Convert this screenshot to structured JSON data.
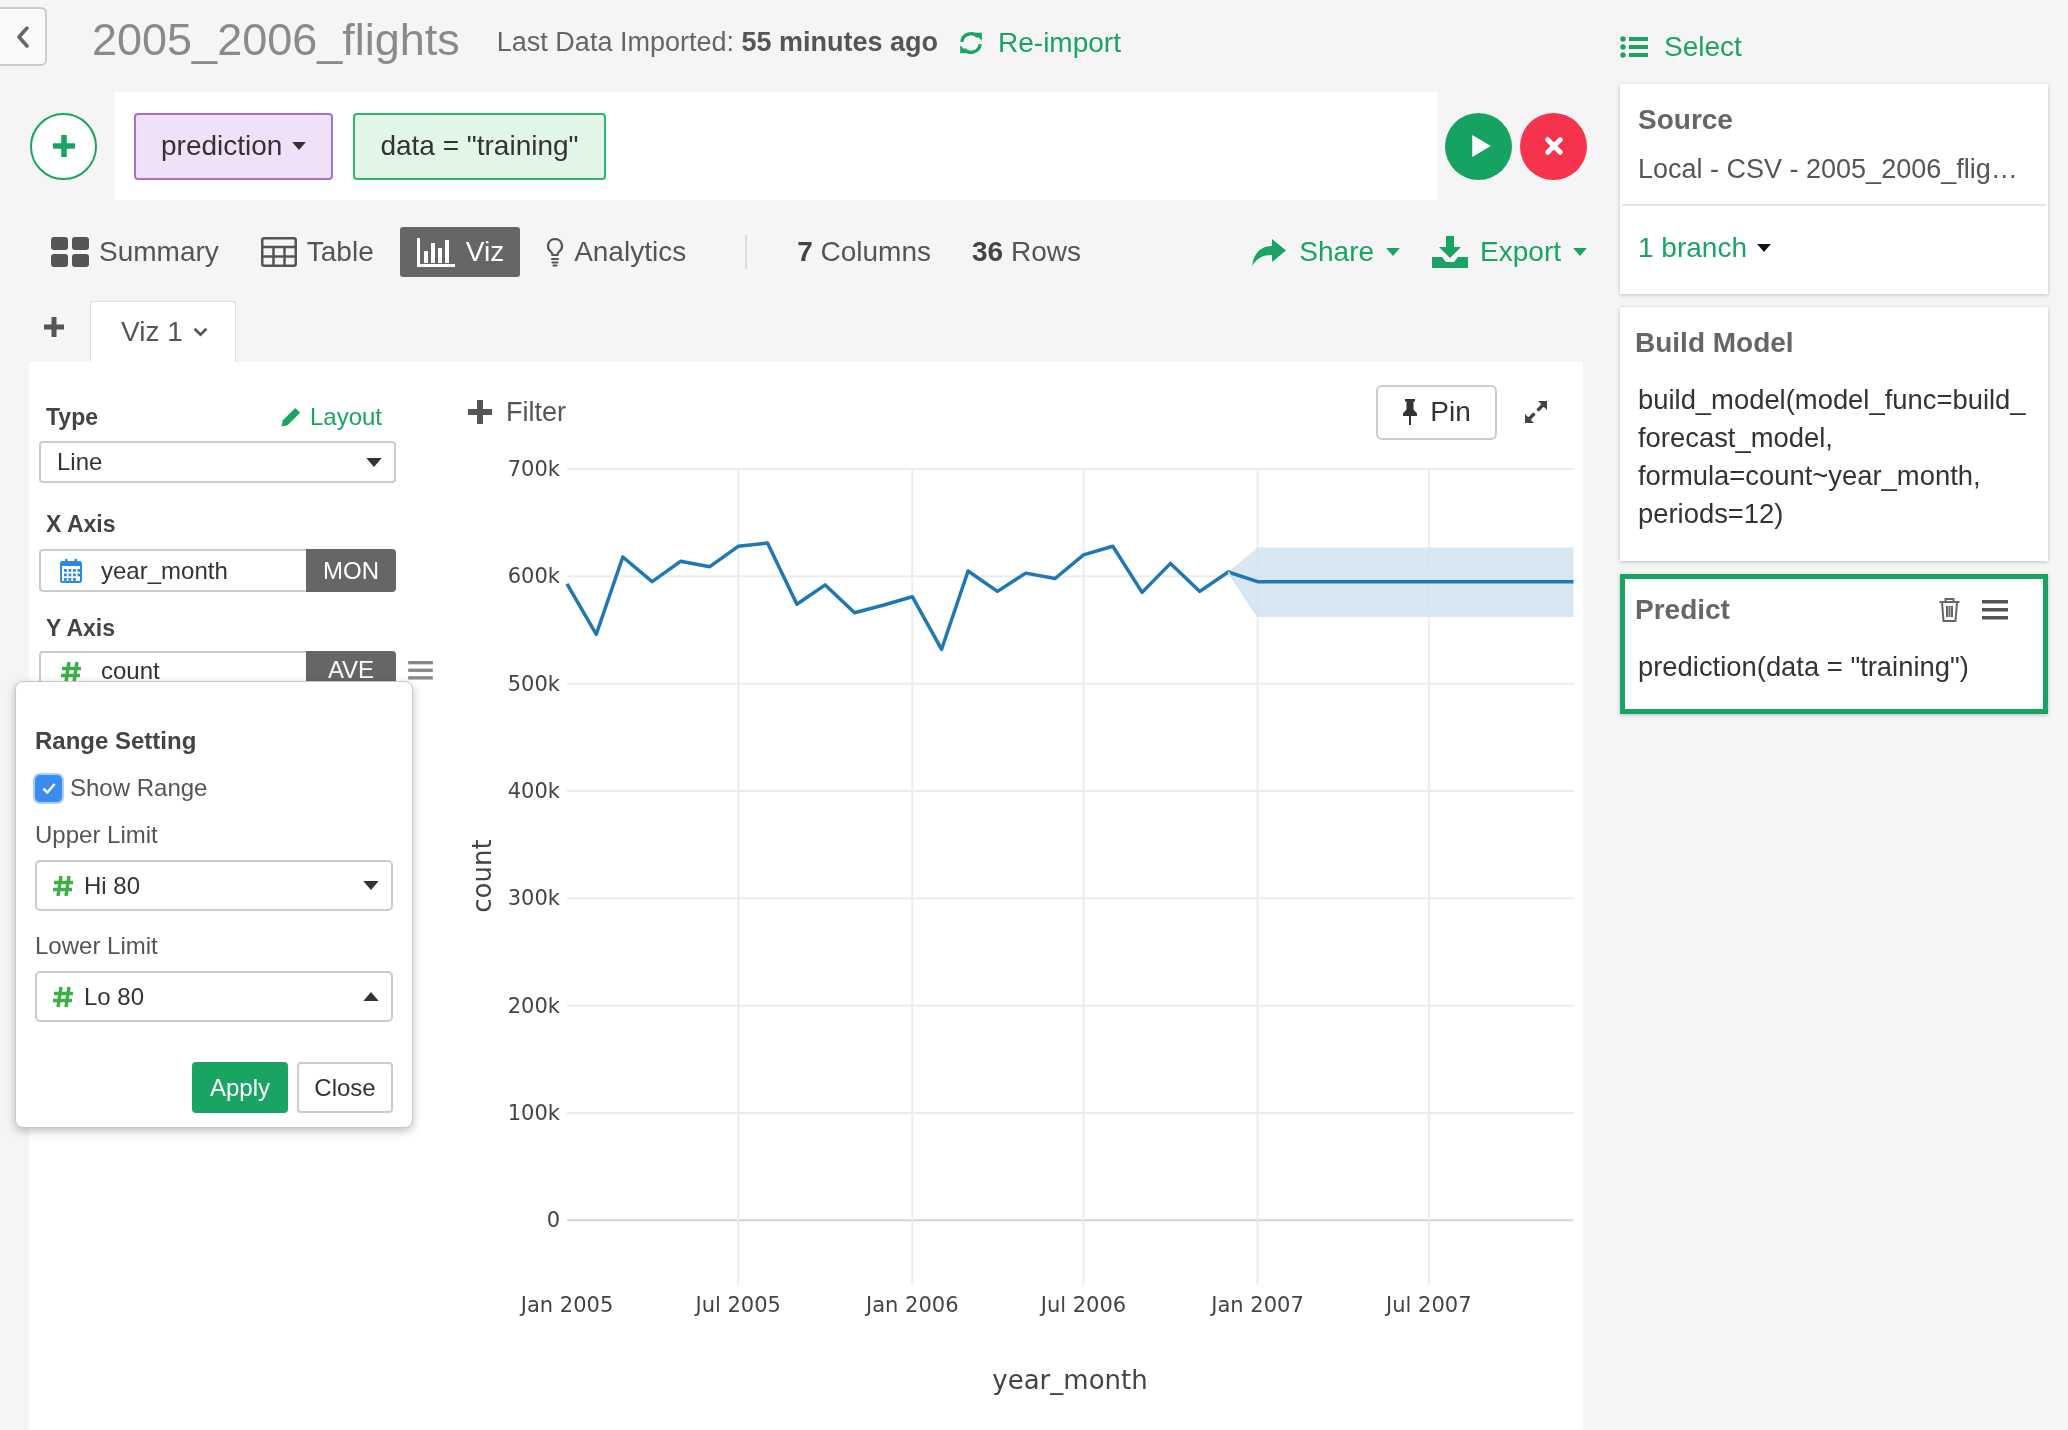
{
  "header": {
    "title": "2005_2006_flights",
    "import_status": "Last Data Imported: **55 minutes ago**",
    "reimport": "Re-import"
  },
  "command": {
    "function": "prediction",
    "argument": "data = \"training\""
  },
  "view_tabs": [
    {
      "label": "Summary",
      "kind": "summary",
      "selected": false
    },
    {
      "label": "Table",
      "kind": "table",
      "selected": false
    },
    {
      "label": "Viz",
      "kind": "viz",
      "selected": true
    },
    {
      "label": "Analytics",
      "kind": "analytics",
      "selected": false
    }
  ],
  "stats": [
    "**7** Columns",
    "**36** Rows"
  ],
  "actions": [
    {
      "label": "Share",
      "kind": "share"
    },
    {
      "label": "Export",
      "kind": "export"
    }
  ],
  "viz_tabs": [
    {
      "label": "Viz 1",
      "selected": true
    }
  ],
  "config": {
    "type_label": "Type",
    "layout_link": "Layout",
    "chart_type": "Line",
    "x_axis": {
      "label": "X Axis",
      "kind": "date",
      "column": "year_month",
      "function": "MON"
    },
    "y_axis": {
      "label": "Y Axis",
      "kind": "number",
      "column": "count",
      "function": "AVE"
    }
  },
  "range_popup": {
    "title": "Range Setting",
    "show_range": {
      "label": "Show Range",
      "checked": true
    },
    "upper_limit": {
      "label": "Upper Limit",
      "kind": "number",
      "value": "Hi 80",
      "expanded": false
    },
    "lower_limit": {
      "label": "Lower Limit",
      "kind": "number",
      "value": "Lo 80",
      "expanded": true
    },
    "buttons": [
      {
        "label": "Apply",
        "kind": "primary"
      },
      {
        "label": "Close",
        "kind": "default"
      }
    ]
  },
  "chart": {
    "filter": "Filter",
    "pin": "Pin",
    "chart_data": [
      {
        "type": "line",
        "xlabel": "year_month",
        "ylabel": "count",
        "x": [
          "2005-01-01",
          "2005-02-01",
          "2005-03-01",
          "2005-04-01",
          "2005-05-01",
          "2005-06-01",
          "2005-07-01",
          "2005-08-01",
          "2005-09-01",
          "2005-10-01",
          "2005-11-01",
          "2005-12-01",
          "2006-01-01",
          "2006-02-01",
          "2006-03-01",
          "2006-04-01",
          "2006-05-01",
          "2006-06-01",
          "2006-07-01",
          "2006-08-01",
          "2006-09-01",
          "2006-10-01",
          "2006-11-01",
          "2006-12-01",
          "2007-01-01",
          "2007-02-01",
          "2007-03-01",
          "2007-04-01",
          "2007-05-01",
          "2007-06-01",
          "2007-07-01",
          "2007-08-01",
          "2007-09-01",
          "2007-10-01",
          "2007-11-01",
          "2007-12-01"
        ],
        "xlim": [
          "2005-01-01",
          "2007-12-01"
        ],
        "ylim": [
          -60000,
          700000
        ],
        "xticks": [
          {
            "value": "2005-01-01",
            "label": "Jan 2005"
          },
          {
            "value": "2005-07-01",
            "label": "Jul 2005"
          },
          {
            "value": "2006-01-01",
            "label": "Jan 2006"
          },
          {
            "value": "2006-07-01",
            "label": "Jul 2006"
          },
          {
            "value": "2007-01-01",
            "label": "Jan 2007"
          },
          {
            "value": "2007-07-01",
            "label": "Jul 2007"
          }
        ],
        "yticks": [
          {
            "value": 0,
            "label": "0"
          },
          {
            "value": 100000,
            "label": "100k"
          },
          {
            "value": 200000,
            "label": "200k"
          },
          {
            "value": 300000,
            "label": "300k"
          },
          {
            "value": 400000,
            "label": "400k"
          },
          {
            "value": 500000,
            "label": "500k"
          },
          {
            "value": 600000,
            "label": "600k"
          },
          {
            "value": 700000,
            "label": "700k"
          }
        ],
        "grid": true,
        "series": [
          {
            "color": "#1f77b4",
            "values": [
              593000,
              546000,
              618000,
              595000,
              614000,
              609000,
              628000,
              631000,
              574000,
              592000,
              566000,
              573000,
              581000,
              532000,
              605000,
              586000,
              603000,
              598000,
              620000,
              628000,
              585000,
              612000,
              586000,
              604000,
              595000,
              595000,
              595000,
              595000,
              595000,
              595000,
              595000,
              595000,
              595000,
              595000,
              595000,
              595000
            ]
          },
          {
            "type": "area",
            "color": "#d2e3f0",
            "values": [
              null,
              null,
              null,
              null,
              null,
              null,
              null,
              null,
              null,
              null,
              null,
              null,
              null,
              null,
              null,
              null,
              null,
              null,
              null,
              null,
              null,
              null,
              null,
              604000,
              627000,
              627000,
              627000,
              627000,
              627000,
              627000,
              627000,
              627000,
              627000,
              627000,
              627000,
              627000
            ]
          },
          {
            "color": "#d2e3f0",
            "values": [
              null,
              null,
              null,
              null,
              null,
              null,
              null,
              null,
              null,
              null,
              null,
              null,
              null,
              null,
              null,
              null,
              null,
              null,
              null,
              null,
              null,
              null,
              null,
              604000,
              563000,
              563000,
              563000,
              563000,
              563000,
              563000,
              563000,
              563000,
              563000,
              563000,
              563000,
              563000
            ]
          }
        ]
      }
    ]
  },
  "sidebar": {
    "select": "Select",
    "source": {
      "title": "Source",
      "detail": "Local - CSV - 2005_2006_flig…",
      "branches": "1 branch"
    },
    "steps": [
      {
        "title": "Build Model",
        "code": "build_model(model_func=build_forecast_model, formula=count~year_month, periods=12)",
        "selected": false
      },
      {
        "title": "Predict",
        "code": "prediction(data = \"training\")",
        "selected": true
      }
    ]
  }
}
